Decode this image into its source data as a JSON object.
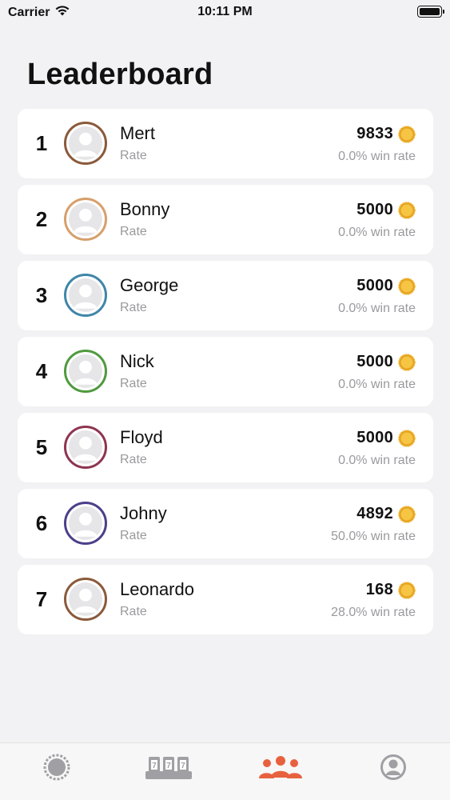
{
  "status_bar": {
    "carrier": "Carrier",
    "time": "10:11 PM"
  },
  "title": "Leaderboard",
  "players": [
    {
      "rank": "1",
      "name": "Mert",
      "subtitle": "Rate",
      "coins": "9833",
      "win_rate": "0.0% win rate",
      "ring_color": "#8a5a3b"
    },
    {
      "rank": "2",
      "name": "Bonny",
      "subtitle": "Rate",
      "coins": "5000",
      "win_rate": "0.0% win rate",
      "ring_color": "#d79f6c"
    },
    {
      "rank": "3",
      "name": "George",
      "subtitle": "Rate",
      "coins": "5000",
      "win_rate": "0.0% win rate",
      "ring_color": "#3f86a8"
    },
    {
      "rank": "4",
      "name": "Nick",
      "subtitle": "Rate",
      "coins": "5000",
      "win_rate": "0.0% win rate",
      "ring_color": "#4f9a3e"
    },
    {
      "rank": "5",
      "name": "Floyd",
      "subtitle": "Rate",
      "coins": "5000",
      "win_rate": "0.0% win rate",
      "ring_color": "#8e3550"
    },
    {
      "rank": "6",
      "name": "Johny",
      "subtitle": "Rate",
      "coins": "4892",
      "win_rate": "50.0% win rate",
      "ring_color": "#4d3f8a"
    },
    {
      "rank": "7",
      "name": "Leonardo",
      "subtitle": "Rate",
      "coins": "168",
      "win_rate": "28.0% win rate",
      "ring_color": "#8a5a3b"
    }
  ],
  "tabs": [
    {
      "id": "roulette",
      "icon": "roulette-icon",
      "active": false
    },
    {
      "id": "slots",
      "icon": "slot-machine-icon",
      "label": "777",
      "active": false
    },
    {
      "id": "leaderboard",
      "icon": "people-group-icon",
      "active": true
    },
    {
      "id": "profile",
      "icon": "profile-icon",
      "active": false
    }
  ],
  "colors": {
    "accent": "#e8613f",
    "inactive_icon": "#9a9a9e",
    "coin": "#f2b531"
  }
}
